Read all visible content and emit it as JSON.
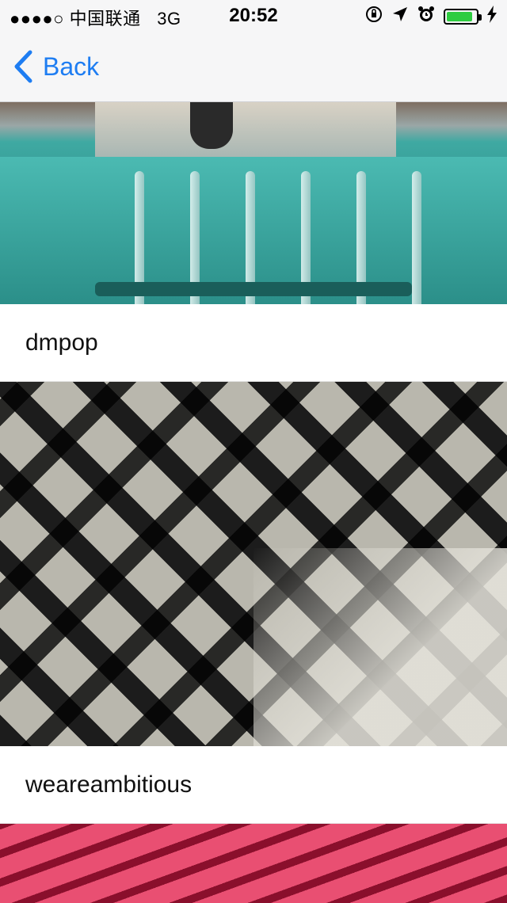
{
  "status_bar": {
    "signal": "●●●●○",
    "carrier": "中国联通",
    "network": "3G",
    "time": "20:52",
    "battery_level": 0.9
  },
  "nav": {
    "back_label": "Back"
  },
  "feed": [
    {
      "caption": "dmpop",
      "image": "teal-car-photo"
    },
    {
      "caption": "weareambitious",
      "image": "staircase-photo"
    },
    {
      "caption": "",
      "image": "red-stadium-seats-photo"
    }
  ],
  "colors": {
    "accent": "#1e7df2",
    "navbar_bg": "#f6f6f7",
    "text": "#111111",
    "battery": "#2ecc40"
  },
  "icons": [
    "orientation-lock-icon",
    "location-arrow-icon",
    "alarm-icon",
    "battery-icon",
    "charging-bolt-icon",
    "back-chevron-icon"
  ]
}
